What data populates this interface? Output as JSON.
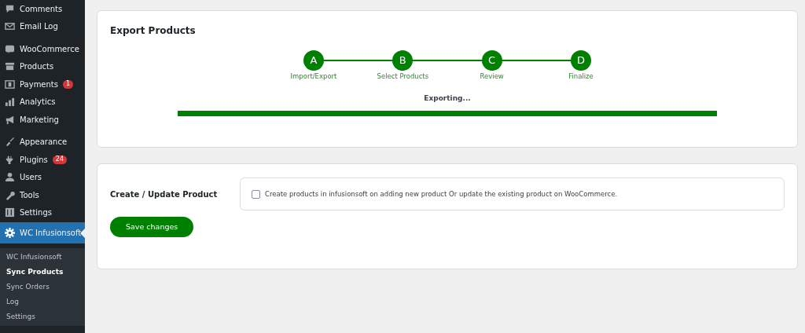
{
  "sidebar": {
    "groups": [
      {
        "items": [
          {
            "label": "Comments",
            "selected": false
          },
          {
            "label": "Email Log",
            "selected": false
          }
        ]
      },
      {
        "items": [
          {
            "label": "WooCommerce",
            "selected": false
          },
          {
            "label": "Products",
            "selected": false
          },
          {
            "label": "Payments",
            "selected": false,
            "badge": "1"
          },
          {
            "label": "Analytics",
            "selected": false
          },
          {
            "label": "Marketing",
            "selected": false
          }
        ]
      },
      {
        "items": [
          {
            "label": "Appearance",
            "selected": false
          },
          {
            "label": "Plugins",
            "selected": false,
            "badge": "24"
          },
          {
            "label": "Users",
            "selected": false
          },
          {
            "label": "Tools",
            "selected": false
          },
          {
            "label": "Settings",
            "selected": false
          }
        ]
      },
      {
        "items": [
          {
            "label": "WC Infusionsoft",
            "selected": true
          }
        ]
      }
    ],
    "submenu": [
      {
        "label": "WC Infusionsoft",
        "selected": false
      },
      {
        "label": "Sync Products",
        "selected": true
      },
      {
        "label": "Sync Orders",
        "selected": false
      },
      {
        "label": "Log",
        "selected": false
      },
      {
        "label": "Settings",
        "selected": false
      }
    ]
  },
  "export_card": {
    "title": "Export Products",
    "steps": [
      {
        "letter": "A",
        "label": "Import/Export"
      },
      {
        "letter": "B",
        "label": "Select Products"
      },
      {
        "letter": "C",
        "label": "Review"
      },
      {
        "letter": "D",
        "label": "Finalize"
      }
    ],
    "status": "Exporting...",
    "progress": {
      "level": 1
    }
  },
  "settings_card": {
    "field_label": "Create / Update Product",
    "option": {
      "label": "Create products in infusionsoft on adding new product Or update the existing product on WooCommerce.",
      "checked": false
    },
    "button": "Save changes"
  }
}
